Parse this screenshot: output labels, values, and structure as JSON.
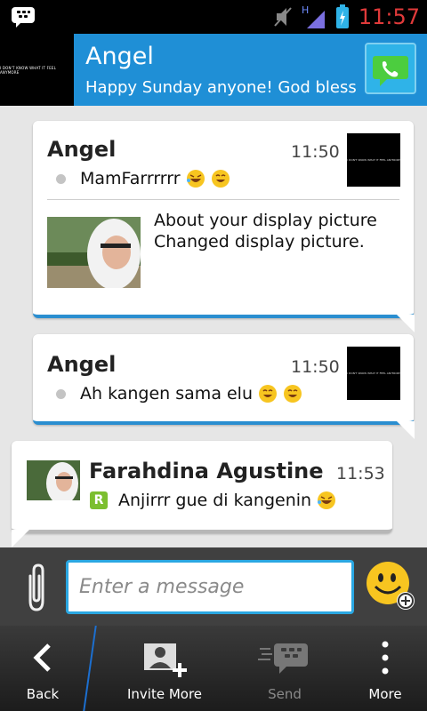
{
  "status_bar": {
    "time": "11:57",
    "network": "H",
    "icons": [
      "bbm-icon",
      "mute-icon",
      "signal-icon",
      "battery-icon"
    ]
  },
  "header": {
    "contact_name": "Angel",
    "status_message": "Happy Sunday anyone! God bless",
    "avatar_text": "I DON'T KNOW WHAT IT FEEL ANYMORE",
    "call_icon": "phone-icon"
  },
  "messages": [
    {
      "sender": "Angel",
      "time": "11:50",
      "text": "MamFarrrrrr",
      "emoji": [
        "laughing-emoji",
        "grinning-emoji"
      ],
      "update_title": "About your display picture",
      "update_text": "Changed display picture."
    },
    {
      "sender": "Angel",
      "time": "11:50",
      "text": "Ah kangen sama elu",
      "emoji": [
        "grinning-emoji",
        "grinning-emoji"
      ]
    },
    {
      "sender": "Farahdina Agustine",
      "time": "11:53",
      "badge": "R",
      "text": "Anjirrr gue di kangenin",
      "emoji": [
        "laughing-emoji"
      ]
    }
  ],
  "composer": {
    "placeholder": "Enter a message"
  },
  "bottom_bar": {
    "back_label": "Back",
    "invite_label": "Invite More",
    "send_label": "Send",
    "more_label": "More"
  },
  "colors": {
    "header_bg": "#1f8fd6",
    "accent_blue": "#2a8ed0",
    "time_red": "#e03a3a"
  }
}
